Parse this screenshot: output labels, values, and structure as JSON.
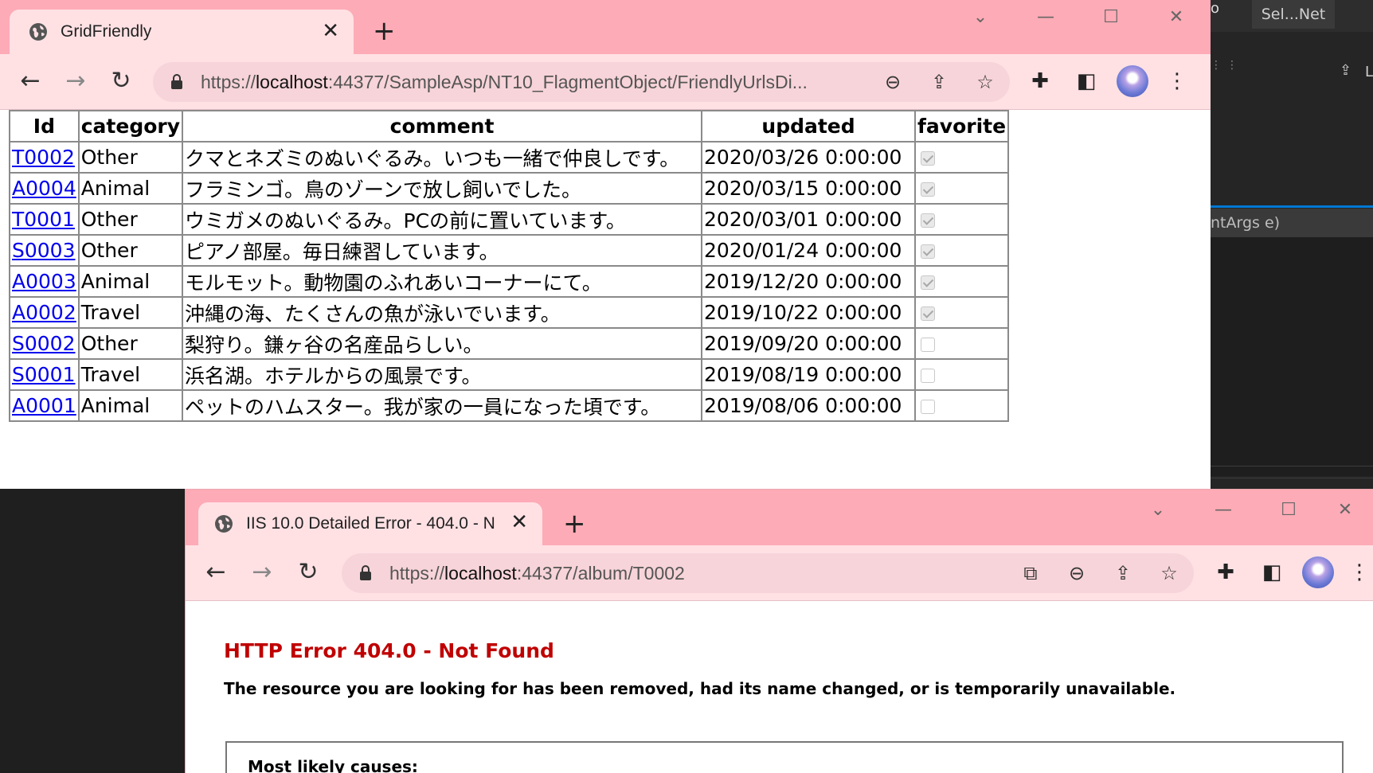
{
  "ide": {
    "tab_label": "Sel...Net",
    "code_snippet": "ntArgs e)",
    "colors": {
      "bg": "#252526",
      "accent": "#0078d4"
    }
  },
  "window1": {
    "tab_title": "GridFriendly",
    "url_prefix": "https://",
    "url_host": "localhost",
    "url_rest": ":44377/SampleAsp/NT10_FlagmentObject/FriendlyUrlsDi...",
    "grid": {
      "headers": [
        "Id",
        "category",
        "comment",
        "updated",
        "favorite"
      ],
      "rows": [
        {
          "id": "T0002",
          "category": "Other",
          "comment": "クマとネズミのぬいぐるみ。いつも一緒で仲良しです。",
          "updated": "2020/03/26 0:00:00",
          "favorite": true
        },
        {
          "id": "A0004",
          "category": "Animal",
          "comment": "フラミンゴ。鳥のゾーンで放し飼いでした。",
          "updated": "2020/03/15 0:00:00",
          "favorite": true
        },
        {
          "id": "T0001",
          "category": "Other",
          "comment": "ウミガメのぬいぐるみ。PCの前に置いています。",
          "updated": "2020/03/01 0:00:00",
          "favorite": true
        },
        {
          "id": "S0003",
          "category": "Other",
          "comment": "ピアノ部屋。毎日練習しています。",
          "updated": "2020/01/24 0:00:00",
          "favorite": true
        },
        {
          "id": "A0003",
          "category": "Animal",
          "comment": "モルモット。動物園のふれあいコーナーにて。",
          "updated": "2019/12/20 0:00:00",
          "favorite": true
        },
        {
          "id": "A0002",
          "category": "Travel",
          "comment": "沖縄の海、たくさんの魚が泳いでいます。",
          "updated": "2019/10/22 0:00:00",
          "favorite": true
        },
        {
          "id": "S0002",
          "category": "Other",
          "comment": "梨狩り。鎌ヶ谷の名産品らしい。",
          "updated": "2019/09/20 0:00:00",
          "favorite": false
        },
        {
          "id": "S0001",
          "category": "Travel",
          "comment": "浜名湖。ホテルからの風景です。",
          "updated": "2019/08/19 0:00:00",
          "favorite": false
        },
        {
          "id": "A0001",
          "category": "Animal",
          "comment": "ペットのハムスター。我が家の一員になった頃です。",
          "updated": "2019/08/06 0:00:00",
          "favorite": false
        }
      ]
    }
  },
  "window2": {
    "tab_title": "IIS 10.0 Detailed Error - 404.0 - N",
    "url_prefix": "https://",
    "url_host": "localhost",
    "url_rest": ":44377/album/T0002",
    "error_title": "HTTP Error 404.0 - Not Found",
    "error_description": "The resource you are looking for has been removed, had its name changed, or is temporarily unavailable.",
    "causes_heading": "Most likely causes:"
  },
  "browser": {
    "colors": {
      "frame": "#fdabb6",
      "toolbar": "#ffe1e4",
      "omnibox": "#f7d4d9",
      "link": "#0000ee",
      "error": "#c00000"
    }
  }
}
